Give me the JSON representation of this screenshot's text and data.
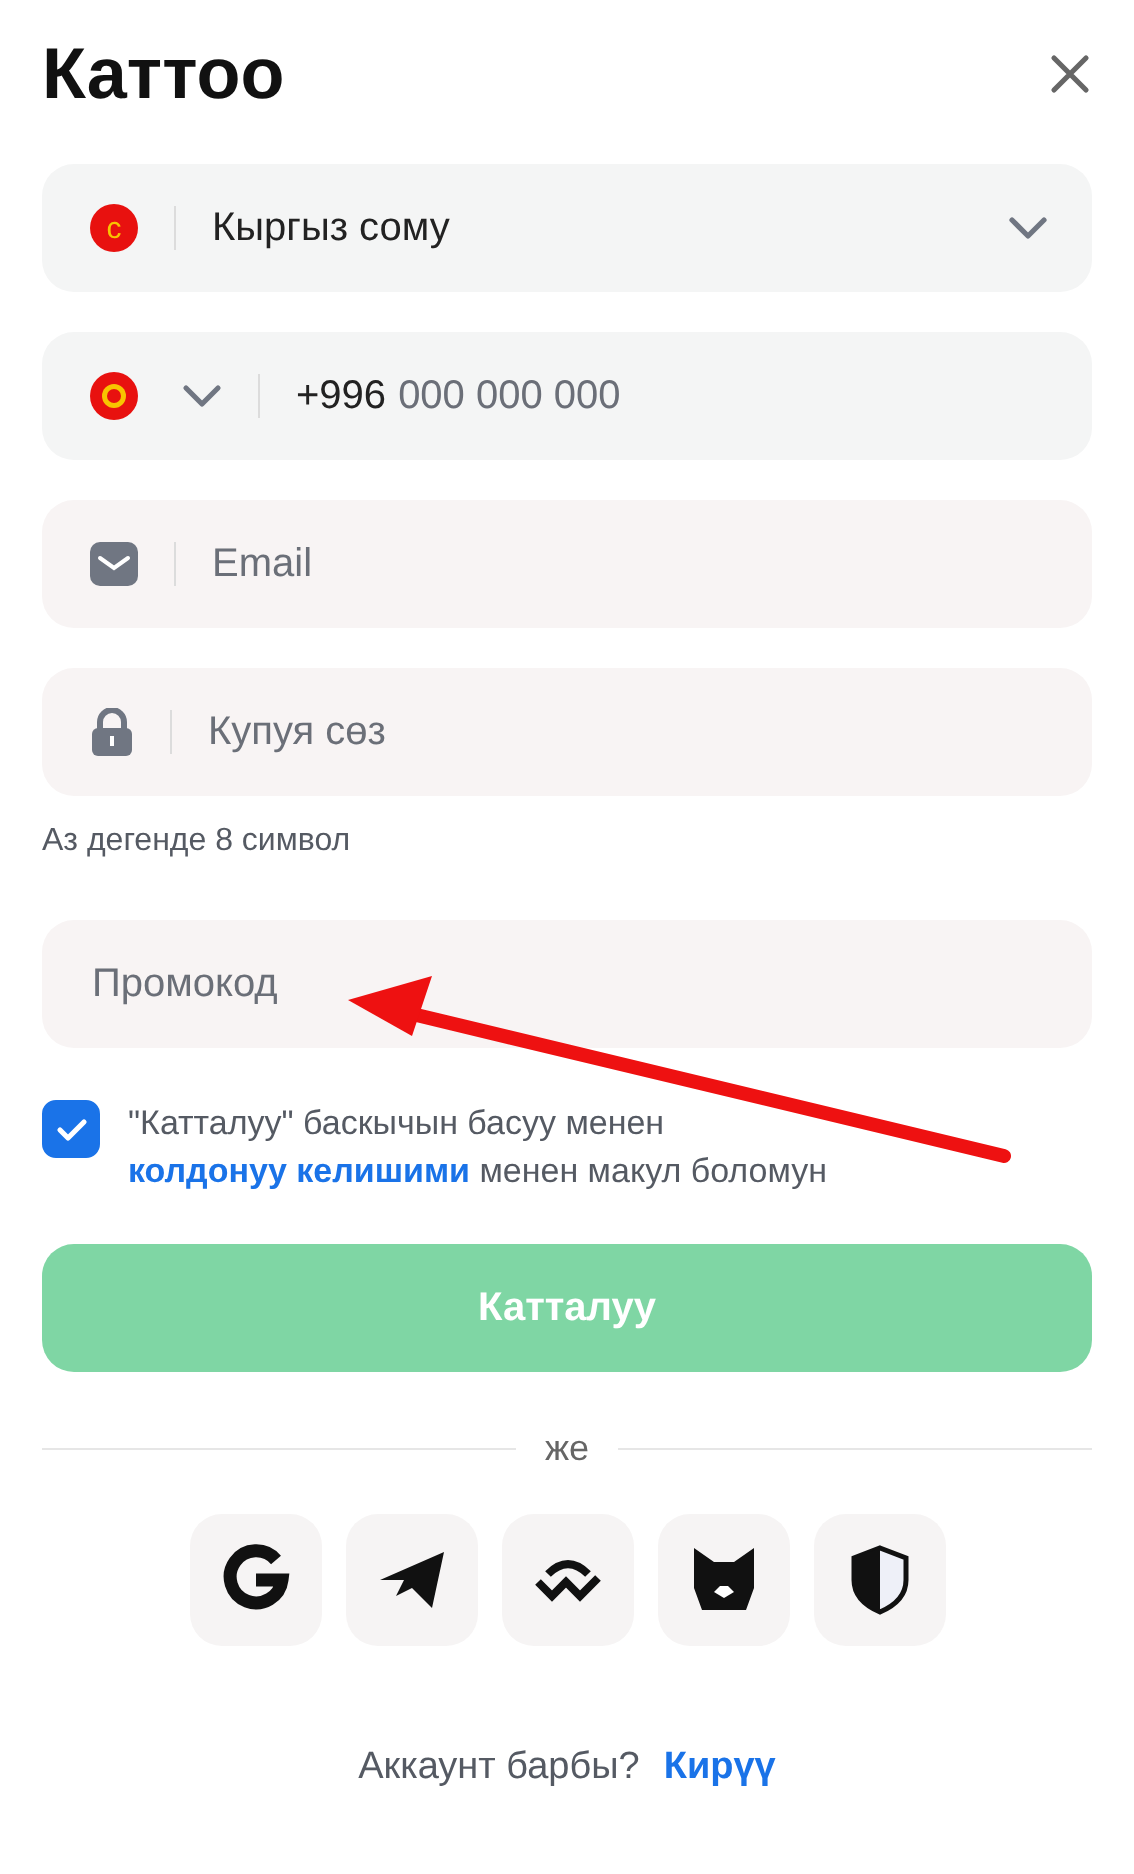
{
  "title": "Каттоо",
  "currency": {
    "value": "Кыргыз сому",
    "symbol": "с"
  },
  "phone": {
    "code": "+996",
    "placeholder": "000 000 000"
  },
  "email": {
    "placeholder": "Email"
  },
  "password": {
    "placeholder": "Купуя сөз",
    "hint": "Аз дегенде 8 символ"
  },
  "promo": {
    "placeholder": "Промокод"
  },
  "agreement": {
    "checked": true,
    "parts": [
      {
        "kind": "plain",
        "text": "\"Катталуу\" баскычын басуу менен "
      },
      {
        "kind": "link",
        "text": "колдонуу келишими"
      },
      {
        "kind": "plain",
        "text": " менен макул боломун"
      }
    ]
  },
  "submit": {
    "label": "Катталуу"
  },
  "divider": "же",
  "socials": [
    {
      "kind": "google"
    },
    {
      "kind": "telegram"
    },
    {
      "kind": "wallet"
    },
    {
      "kind": "fox"
    },
    {
      "kind": "shield"
    }
  ],
  "footer": {
    "question": "Аккаунт барбы?",
    "link": "Кирүү"
  }
}
